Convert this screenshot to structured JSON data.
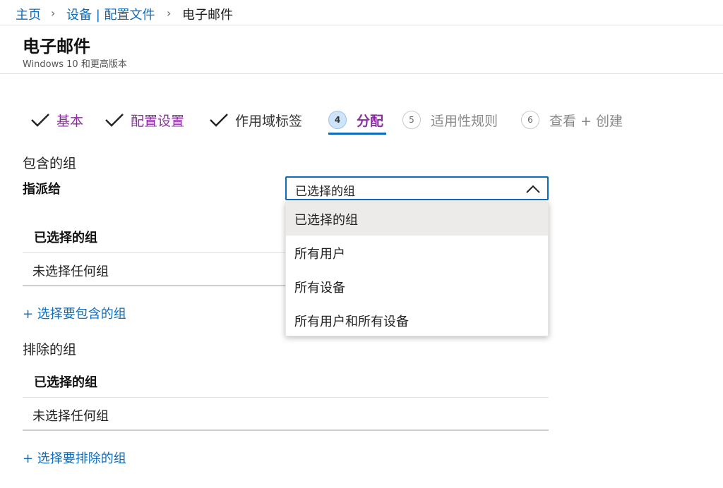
{
  "breadcrumb": {
    "home": "主页",
    "devices": "设备 | 配置文件",
    "current": "电子邮件",
    "separator": "›"
  },
  "header": {
    "title": "电子邮件",
    "subtitle": "Windows 10 和更高版本"
  },
  "wizard": {
    "steps": [
      {
        "label": "基本",
        "state": "done"
      },
      {
        "label": "配置设置",
        "state": "done"
      },
      {
        "label": "作用域标签",
        "state": "done"
      },
      {
        "number": "4",
        "label": "分配",
        "state": "active"
      },
      {
        "number": "5",
        "label": "适用性规则",
        "state": "pending"
      },
      {
        "number": "6",
        "label": "查看 + 创建",
        "state": "pending"
      }
    ]
  },
  "included": {
    "section_label": "包含的组",
    "assign_label": "指派给",
    "grid_header": "已选择的组",
    "empty_row": "未选择任何组",
    "add_link": "+ 选择要包含的组"
  },
  "excluded": {
    "section_label": "排除的组",
    "grid_header": "已选择的组",
    "empty_row": "未选择任何组",
    "add_link": "+ 选择要排除的组"
  },
  "dropdown": {
    "value": "已选择的组",
    "options": [
      "已选择的组",
      "所有用户",
      "所有设备",
      "所有用户和所有设备"
    ],
    "selected_index": 0
  },
  "colors": {
    "accent": "#0f6cbd",
    "step_purple": "#8a2f9f"
  }
}
